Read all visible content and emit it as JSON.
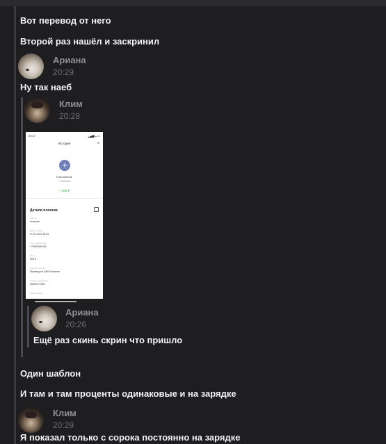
{
  "messages": {
    "m1": "Вот перевод от него",
    "m2": "Второй раз нашёл и заскринил",
    "ariana_reply": {
      "author": "Ариана",
      "time": "20:29",
      "text": "Ну так наеб"
    },
    "quoted_klim": {
      "author": "Клим",
      "time": "20:28"
    },
    "quoted_ariana": {
      "author": "Ариана",
      "time": "20:26",
      "text": "Ещё раз скинь скрин что пришло"
    },
    "m3": "Один шаблон",
    "m4": "И там и там проценты одинаковые и на зарядке",
    "klim_msg": {
      "author": "Клим",
      "time": "20:29",
      "text": "Я показал только с сорока постоянно на зарядке"
    }
  },
  "screenshot": {
    "status_time": "09:37",
    "status_right": "▂▄▆ ◒ ▭",
    "title": "История",
    "menu_icon": "≡",
    "plus_icon": "+",
    "recipient_name": "Пополнение",
    "recipient_phone": "+79081650",
    "amount": "+ 599 ₽",
    "section_title": "Детали платежа",
    "rows": [
      {
        "label": "Статус",
        "value": "Успешно"
      },
      {
        "label": "Дата и время",
        "value": "07.02.2024 19:01"
      },
      {
        "label": "Счет пополнения",
        "value": "+79081650045"
      },
      {
        "label": "Итого",
        "value": "599 ₽"
      },
      {
        "label": "Способ оплаты",
        "value": "Перевод на QIWI Кошелек"
      },
      {
        "label": "Номер транзакции",
        "value": "35400772090"
      },
      {
        "label": "Номер карты",
        "value": ""
      }
    ]
  },
  "colors": {
    "background": "#1e1e21",
    "author": "#8e8e94",
    "time": "#6e6e74",
    "text": "#f2f2f2"
  }
}
